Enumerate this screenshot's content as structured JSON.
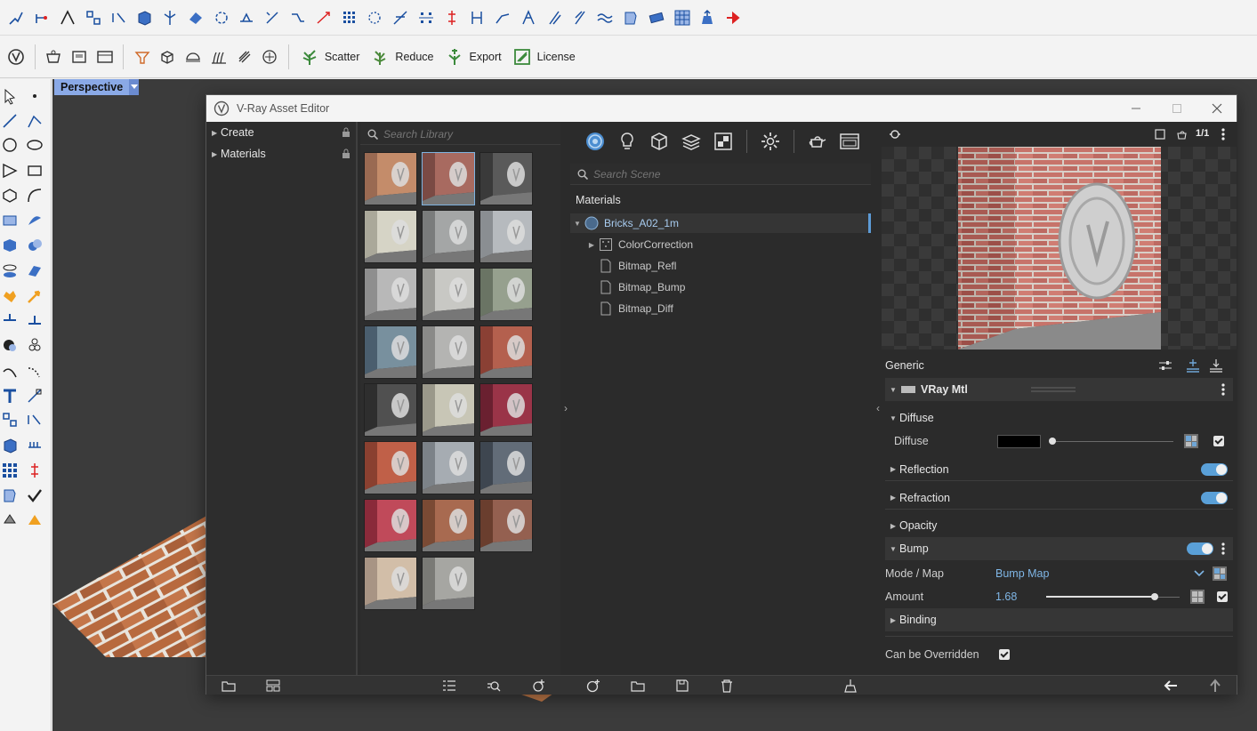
{
  "app": {
    "rhino_toolbar": {
      "vray_buttons": [
        {
          "label": "Scatter"
        },
        {
          "label": "Reduce"
        },
        {
          "label": "Export"
        },
        {
          "label": "License"
        }
      ]
    },
    "viewport": {
      "tab_label": "Perspective"
    }
  },
  "asset_editor": {
    "title": "V-Ray Asset Editor",
    "tree": {
      "items": [
        {
          "label": "Create"
        },
        {
          "label": "Materials"
        }
      ]
    },
    "library": {
      "search_placeholder": "Search Library",
      "thumbnail_count": 23,
      "selected_index": 1
    },
    "scene": {
      "search_placeholder": "Search Scene",
      "section_title": "Materials",
      "material": {
        "name": "Bricks_A02_1m",
        "children": [
          {
            "label": "ColorCorrection",
            "expandable": true
          },
          {
            "label": "Bitmap_Refl"
          },
          {
            "label": "Bitmap_Bump"
          },
          {
            "label": "Bitmap_Diff"
          }
        ]
      }
    },
    "properties": {
      "preview_ratio": "1/1",
      "group_label": "Generic",
      "material_type": "VRay Mtl",
      "diffuse": {
        "section": "Diffuse",
        "label": "Diffuse",
        "color": "#000000",
        "enabled": true
      },
      "reflection": {
        "label": "Reflection",
        "enabled": true
      },
      "refraction": {
        "label": "Refraction",
        "enabled": true
      },
      "opacity": {
        "label": "Opacity"
      },
      "bump": {
        "label": "Bump",
        "enabled": true,
        "mode_label": "Mode / Map",
        "mode_value": "Bump Map",
        "amount_label": "Amount",
        "amount_value": "1.68",
        "amount_checked": true
      },
      "binding": {
        "label": "Binding"
      },
      "can_be_overridden": {
        "label": "Can be Overridden",
        "checked": true
      }
    },
    "colors": {
      "accent": "#5aa0d8",
      "panel_bg": "#2b2b2b",
      "selected_text": "#a8ccf0"
    }
  }
}
